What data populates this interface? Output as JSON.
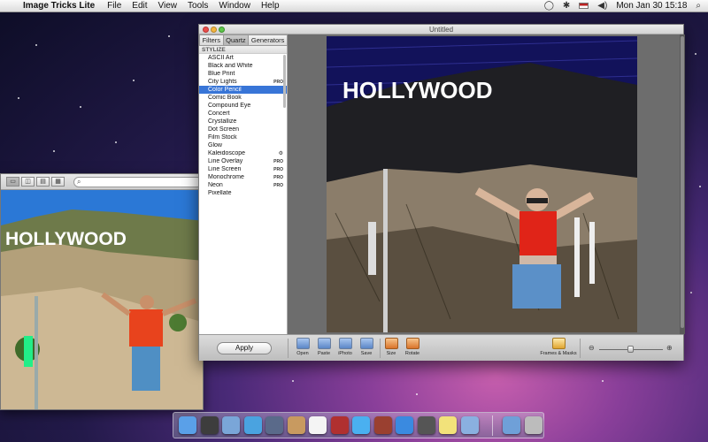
{
  "menubar": {
    "app_name": "Image Tricks Lite",
    "menus": [
      "File",
      "Edit",
      "View",
      "Tools",
      "Window",
      "Help"
    ],
    "clock": "Mon Jan 30  15:18"
  },
  "back_window": {
    "search_placeholder": ""
  },
  "window": {
    "title": "Untitled",
    "tabs": [
      "Filters",
      "Quartz",
      "Generators"
    ],
    "active_tab": "Quartz",
    "section_header": "STYLIZE",
    "selected_filter": "Color Pencil",
    "filters": [
      {
        "name": "ASCII Art",
        "badge": ""
      },
      {
        "name": "Black and White",
        "badge": ""
      },
      {
        "name": "Blue Print",
        "badge": ""
      },
      {
        "name": "City Lights",
        "badge": "PRO"
      },
      {
        "name": "Color Pencil",
        "badge": ""
      },
      {
        "name": "Comic Book",
        "badge": ""
      },
      {
        "name": "Compound Eye",
        "badge": ""
      },
      {
        "name": "Concert",
        "badge": ""
      },
      {
        "name": "Crystallize",
        "badge": ""
      },
      {
        "name": "Dot Screen",
        "badge": ""
      },
      {
        "name": "Film Stock",
        "badge": ""
      },
      {
        "name": "Glow",
        "badge": ""
      },
      {
        "name": "Kaleidoscope",
        "badge": "gear"
      },
      {
        "name": "Line Overlay",
        "badge": "PRO"
      },
      {
        "name": "Line Screen",
        "badge": "PRO"
      },
      {
        "name": "Monochrome",
        "badge": "PRO"
      },
      {
        "name": "Neon",
        "badge": "PRO"
      },
      {
        "name": "Pixellate",
        "badge": ""
      }
    ],
    "sign_text": "HOLLYWOOD",
    "apply_label": "Apply",
    "tools": [
      "Open",
      "Paste",
      "iPhoto",
      "Save",
      "Size",
      "Rotate",
      "Frames & Masks"
    ]
  },
  "dock_icons": [
    "finder-icon",
    "dashboard-icon",
    "mail-stamp-icon",
    "safari-icon",
    "facetime-icon",
    "contacts-icon",
    "calendar-icon",
    "photo-booth-icon",
    "itunes-icon",
    "photo-icon",
    "app-store-icon",
    "time-machine-icon",
    "notes-icon",
    "folder-icon",
    "downloads-icon",
    "trash-icon"
  ]
}
